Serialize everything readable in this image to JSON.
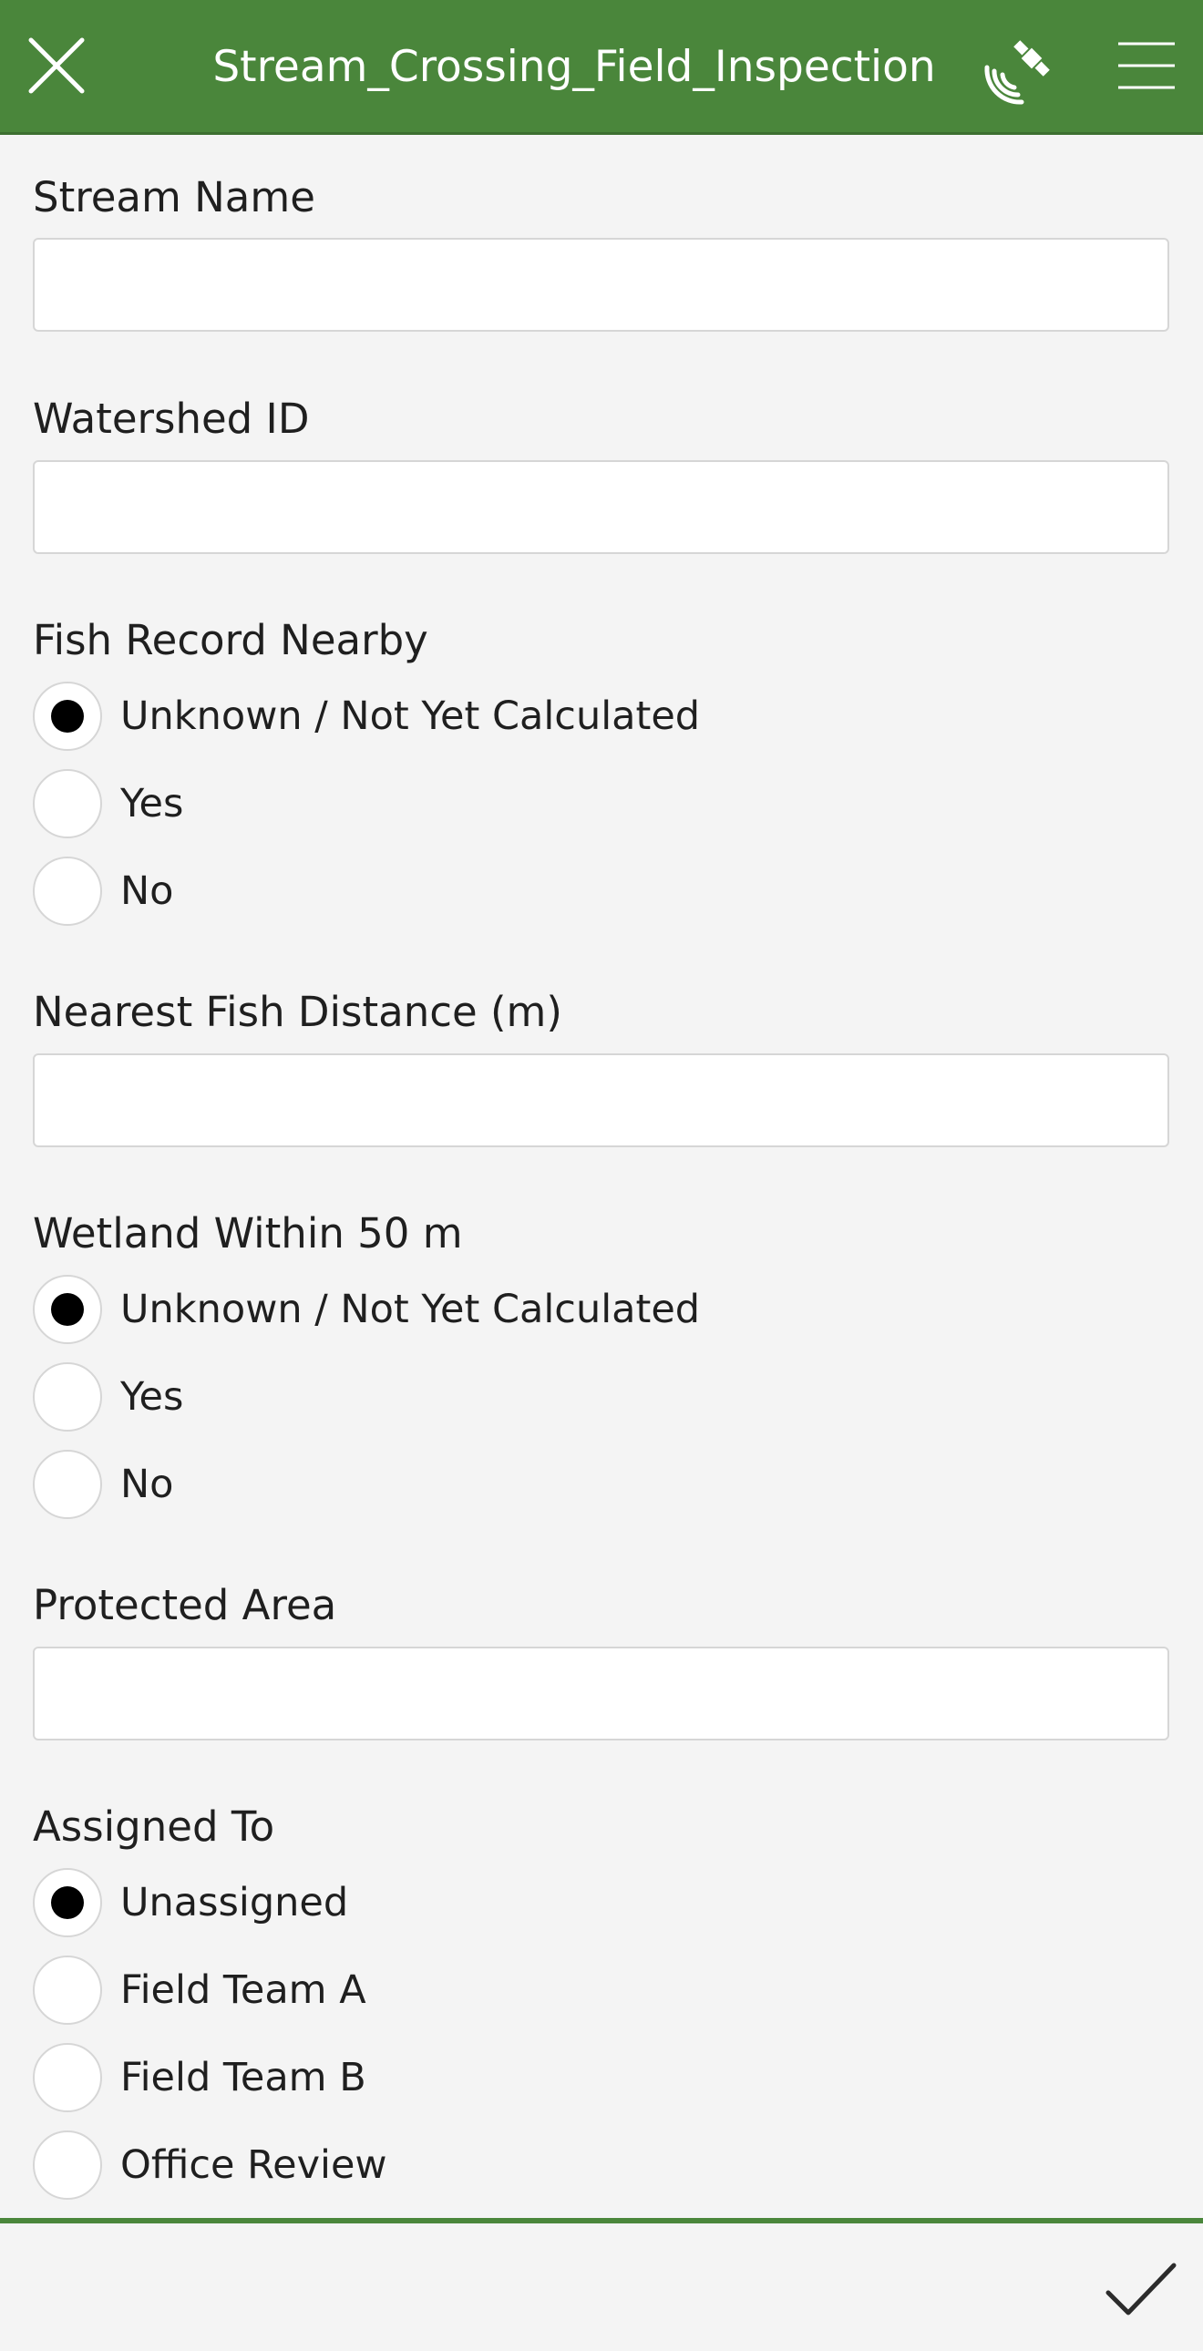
{
  "header": {
    "title": "Stream_Crossing_Field_Inspection",
    "close_icon": "close-icon",
    "gps_icon": "satellite-gps-icon",
    "menu_icon": "hamburger-menu-icon",
    "background_color": "#4a863b"
  },
  "form": {
    "stream_name": {
      "label": "Stream Name",
      "value": ""
    },
    "watershed_id": {
      "label": "Watershed ID",
      "value": ""
    },
    "fish_record_nearby": {
      "label": "Fish Record Nearby",
      "options": [
        "Unknown / Not Yet Calculated",
        "Yes",
        "No"
      ],
      "selected": "Unknown / Not Yet Calculated"
    },
    "nearest_fish_distance": {
      "label": "Nearest Fish Distance (m)",
      "value": ""
    },
    "wetland_within_50m": {
      "label": "Wetland Within 50 m",
      "options": [
        "Unknown / Not Yet Calculated",
        "Yes",
        "No"
      ],
      "selected": "Unknown / Not Yet Calculated"
    },
    "protected_area": {
      "label": "Protected Area",
      "value": ""
    },
    "assigned_to": {
      "label": "Assigned To",
      "options": [
        "Unassigned",
        "Field Team A",
        "Field Team B",
        "Office Review"
      ],
      "selected": "Unassigned"
    }
  },
  "footer": {
    "submit_icon": "checkmark-icon"
  }
}
